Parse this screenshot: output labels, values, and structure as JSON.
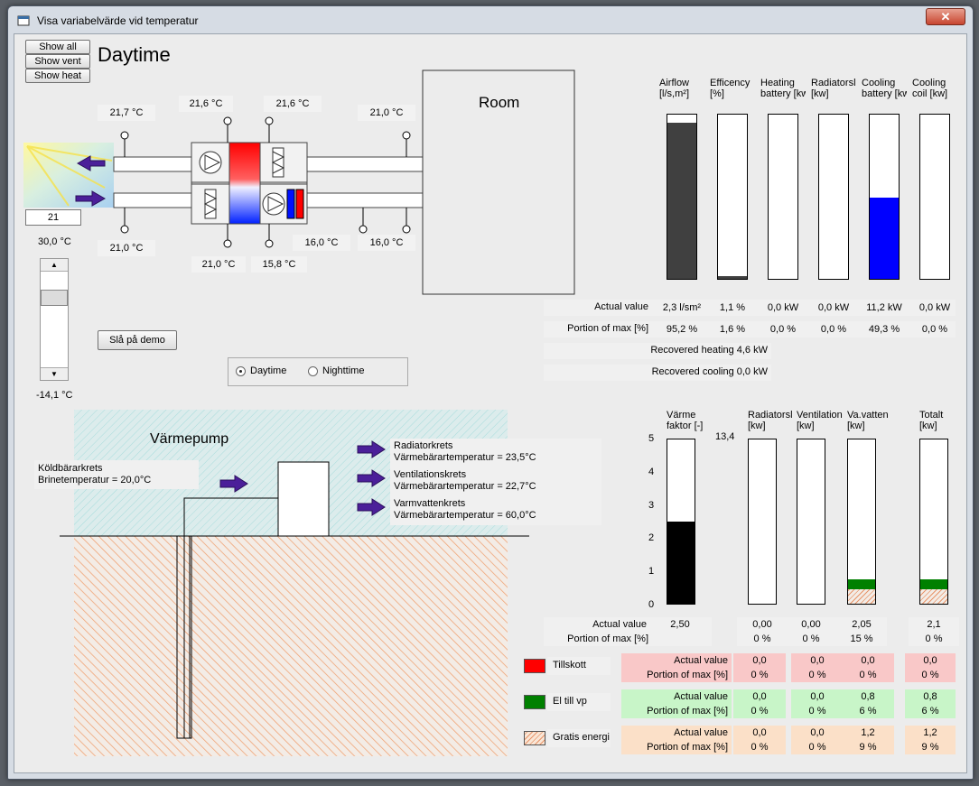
{
  "window": {
    "title": "Visa variabelvärde vid temperatur",
    "close": "✕"
  },
  "buttons": {
    "show_all": "Show all",
    "show_vent": "Show vent",
    "show_heat": "Show heat",
    "demo": "Slå på demo"
  },
  "mode": {
    "title": "Daytime",
    "options": [
      "Daytime",
      "Nighttime"
    ],
    "selected": "Daytime"
  },
  "ahu": {
    "room_label": "Room",
    "temps": {
      "t_top_left": "21,7 °C",
      "t_top_mid1": "21,6 °C",
      "t_top_mid2": "21,6 °C",
      "t_top_right": "21,0 °C",
      "t_bot_left": "21,0 °C",
      "t_bot_mid1": "21,0 °C",
      "t_bot_mid2": "15,8 °C",
      "t_bot_right1": "16,0 °C",
      "t_bot_right2": "16,0 °C"
    },
    "outdoor_input": "21",
    "outdoor_temp": "30,0 °C",
    "slider_temp": "-14,1 °C",
    "slider_level": 0.78
  },
  "vent_chart": {
    "columns": [
      {
        "h1": "Airflow",
        "h2": "[l/s,m²]",
        "actual": "2,3 l/sm²",
        "portion": "95,2 %",
        "fill": 0.952,
        "color": "#404040"
      },
      {
        "h1": "Efficency",
        "h2": "[%]",
        "actual": "1,1 %",
        "portion": "1,6 %",
        "fill": 0.016,
        "color": "#404040"
      },
      {
        "h1": "Heating",
        "h2": "battery [kw]",
        "actual": "0,0 kW",
        "portion": "0,0 %",
        "fill": 0.0,
        "color": "#ff0000"
      },
      {
        "h1": "Radiatorsl",
        "h2": "[kw]",
        "actual": "0,0 kW",
        "portion": "0,0 %",
        "fill": 0.0,
        "color": "#ff0000"
      },
      {
        "h1": "Cooling",
        "h2": "battery [kw]",
        "actual": "11,2 kW",
        "portion": "49,3 %",
        "fill": 0.493,
        "color": "#0000ff"
      },
      {
        "h1": "Cooling",
        "h2": "coil [kw]",
        "actual": "0,0 kW",
        "portion": "0,0 %",
        "fill": 0.0,
        "color": "#0000ff"
      }
    ],
    "row_actual_label": "Actual value",
    "row_portion_label": "Portion of max [%]",
    "recovered_heating": "Recovered heating 4,6 kW",
    "recovered_cooling": "Recovered cooling 0,0 kW"
  },
  "heatpump": {
    "title": "Värmepump",
    "brine_label": "Köldbärarkrets",
    "brine_temp": "Brinetemperatur = 20,0°C",
    "circuits": [
      {
        "name": "Radiatorkrets",
        "temp": "Värmebärartemperatur = 23,5°C"
      },
      {
        "name": "Ventilationskrets",
        "temp": "Värmebärartemperatur = 22,7°C"
      },
      {
        "name": "Varmvattenkrets",
        "temp": "Värmebärartemperatur = 60,0°C"
      }
    ]
  },
  "hp_chart": {
    "ymax_label": "13,4",
    "yticks": [
      "5",
      "4",
      "3",
      "2",
      "1",
      "0"
    ],
    "columns": [
      {
        "h1": "Värme",
        "h2": "faktor [-]",
        "actual": "2,50",
        "portion": ""
      },
      {
        "h1": "Radiatorsl",
        "h2": "[kw]",
        "actual": "0,00",
        "portion": "0 %"
      },
      {
        "h1": "Ventilation",
        "h2": "[kw]",
        "actual": "0,00",
        "portion": "0 %"
      },
      {
        "h1": "Va.vatten",
        "h2": "[kw]",
        "actual": "2,05",
        "portion": "15 %"
      },
      {
        "h1": "Totalt",
        "h2": "[kw]",
        "actual": "2,1",
        "portion": "0 %"
      }
    ],
    "cop_value": 2.5,
    "cop_max": 5,
    "va_el_fraction": 0.06,
    "va_free_fraction": 0.09,
    "tot_el_fraction": 0.06,
    "tot_free_fraction": 0.09,
    "row_actual_label": "Actual value",
    "row_portion_label": "Portion of max [%]"
  },
  "legend": {
    "tillskott": {
      "label": "Tillskott",
      "color": "#ff0000",
      "bg": "#f9c8c8",
      "actual_label": "Actual value",
      "portion_label": "Portion of max [%]",
      "values": [
        "0,0",
        "0,0",
        "0,0",
        "0,0"
      ],
      "portions": [
        "0 %",
        "0 %",
        "0 %",
        "0 %"
      ]
    },
    "el": {
      "label": "El till vp",
      "color": "#008000",
      "bg": "#c8f5c8",
      "actual_label": "Actual value",
      "portion_label": "Portion of max [%]",
      "values": [
        "0,0",
        "0,0",
        "0,8",
        "0,8"
      ],
      "portions": [
        "0 %",
        "0 %",
        "6 %",
        "6 %"
      ]
    },
    "gratis": {
      "label": "Gratis energi",
      "color": "#f4b183",
      "bg": "#fbe0c8",
      "actual_label": "Actual value",
      "portion_label": "Portion of max [%]",
      "values": [
        "0,0",
        "0,0",
        "1,2",
        "1,2"
      ],
      "portions": [
        "0 %",
        "0 %",
        "9 %",
        "9 %"
      ]
    }
  }
}
